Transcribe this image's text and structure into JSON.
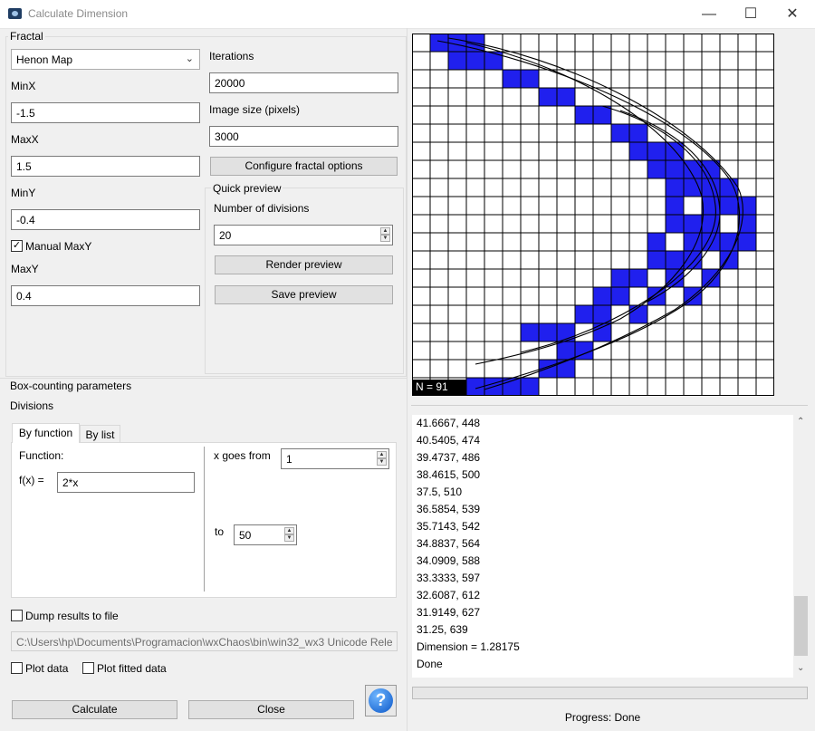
{
  "window": {
    "title": "Calculate Dimension",
    "minimize": "—",
    "maximize": "☐",
    "close": "✕"
  },
  "fractal": {
    "group_label": "Fractal",
    "type_selected": "Henon Map",
    "minx_label": "MinX",
    "minx_value": "-1.5",
    "maxx_label": "MaxX",
    "maxx_value": "1.5",
    "miny_label": "MinY",
    "miny_value": "-0.4",
    "manual_maxy_label": "Manual MaxY",
    "manual_maxy_checked": true,
    "maxy_label": "MaxY",
    "maxy_value": "0.4",
    "iterations_label": "Iterations",
    "iterations_value": "20000",
    "image_size_label": "Image size (pixels)",
    "image_size_value": "3000",
    "configure_label": "Configure fractal options"
  },
  "quick_preview": {
    "group_label": "Quick preview",
    "divisions_label": "Number of divisions",
    "divisions_value": "20",
    "render_label": "Render preview",
    "save_label": "Save preview"
  },
  "box_counting": {
    "group_label": "Box-counting parameters",
    "divisions_label": "Divisions",
    "tabs": [
      {
        "label": "By function"
      },
      {
        "label": "By list"
      }
    ],
    "function_label": "Function:",
    "fx_label": "f(x) =",
    "fx_value": "2*x",
    "x_from_label": "x goes from",
    "x_from_value": "1",
    "to_label": "to",
    "to_value": "50"
  },
  "dump": {
    "label": "Dump results to file",
    "checked": false,
    "path": "C:\\Users\\hp\\Documents\\Programacion\\wxChaos\\bin\\win32_wx3 Unicode Rele"
  },
  "plot_data_label": "Plot data",
  "plot_fitted_label": "Plot fitted data",
  "calculate_label": "Calculate",
  "close_label": "Close",
  "help_icon": "help-icon",
  "preview": {
    "n_label": "N = 91",
    "divisions": 20,
    "fill_color": "#2020ee",
    "filled_cells": [
      [
        1,
        0
      ],
      [
        2,
        0
      ],
      [
        3,
        0
      ],
      [
        2,
        1
      ],
      [
        3,
        1
      ],
      [
        4,
        1
      ],
      [
        5,
        2
      ],
      [
        6,
        2
      ],
      [
        7,
        3
      ],
      [
        8,
        3
      ],
      [
        9,
        4
      ],
      [
        10,
        4
      ],
      [
        11,
        5
      ],
      [
        12,
        5
      ],
      [
        13,
        6
      ],
      [
        12,
        6
      ],
      [
        14,
        6
      ],
      [
        13,
        7
      ],
      [
        15,
        7
      ],
      [
        14,
        7
      ],
      [
        16,
        7
      ],
      [
        15,
        8
      ],
      [
        16,
        8
      ],
      [
        17,
        8
      ],
      [
        14,
        8
      ],
      [
        18,
        9
      ],
      [
        17,
        9
      ],
      [
        14,
        9
      ],
      [
        16,
        9
      ],
      [
        18,
        10
      ],
      [
        15,
        10
      ],
      [
        16,
        10
      ],
      [
        14,
        10
      ],
      [
        17,
        11
      ],
      [
        15,
        11
      ],
      [
        16,
        11
      ],
      [
        13,
        11
      ],
      [
        18,
        11
      ],
      [
        15,
        12
      ],
      [
        14,
        12
      ],
      [
        13,
        12
      ],
      [
        17,
        12
      ],
      [
        12,
        13
      ],
      [
        11,
        13
      ],
      [
        16,
        13
      ],
      [
        14,
        13
      ],
      [
        15,
        14
      ],
      [
        10,
        14
      ],
      [
        11,
        14
      ],
      [
        13,
        14
      ],
      [
        9,
        15
      ],
      [
        10,
        15
      ],
      [
        12,
        15
      ],
      [
        6,
        16
      ],
      [
        7,
        16
      ],
      [
        8,
        16
      ],
      [
        10,
        16
      ],
      [
        9,
        17
      ],
      [
        8,
        17
      ],
      [
        7,
        18
      ],
      [
        8,
        18
      ],
      [
        4,
        19
      ],
      [
        5,
        19
      ],
      [
        6,
        19
      ],
      [
        3,
        19
      ]
    ]
  },
  "results": {
    "lines": [
      "41.6667, 448",
      "40.5405, 474",
      "39.4737, 486",
      "38.4615, 500",
      "37.5, 510",
      "36.5854, 539",
      "35.7143, 542",
      "34.8837, 564",
      "34.0909, 588",
      "33.3333, 597",
      "32.6087, 612",
      "31.9149, 627",
      "31.25, 639",
      "Dimension = 1.28175",
      "Done"
    ]
  },
  "progress": {
    "label": "Progress: Done",
    "fraction": 0
  }
}
